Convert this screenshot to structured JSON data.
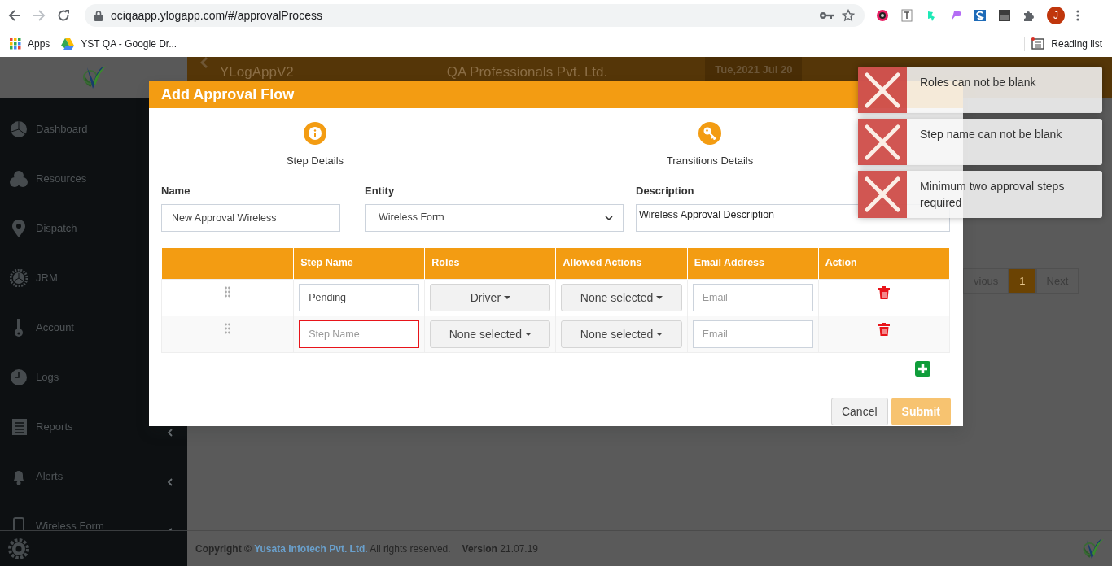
{
  "browser": {
    "url": "ociqaapp.ylogapp.com/#/approvalProcess",
    "profile_initial": "J",
    "bookmarks": [
      {
        "label": "Apps",
        "kind": "apps"
      },
      {
        "label": "YST QA - Google Dr...",
        "kind": "drive"
      }
    ],
    "reading_list": "Reading list"
  },
  "sidebar": {
    "items": [
      {
        "label": "Dashboard",
        "expandable": false
      },
      {
        "label": "Resources",
        "expandable": false
      },
      {
        "label": "Dispatch",
        "expandable": false
      },
      {
        "label": "JRM",
        "expandable": false
      },
      {
        "label": "Account",
        "expandable": false
      },
      {
        "label": "Logs",
        "expandable": false
      },
      {
        "label": "Reports",
        "expandable": true
      },
      {
        "label": "Alerts",
        "expandable": true
      },
      {
        "label": "Wireless Form",
        "expandable": true
      }
    ]
  },
  "header": {
    "app_name": "YLogAppV2",
    "company": "QA Professionals Pvt. Ltd.",
    "date": "Tue,2021 Jul 20"
  },
  "pagination": [
    {
      "label": "vious",
      "selected": false
    },
    {
      "label": "1",
      "selected": true
    },
    {
      "label": "Next",
      "selected": false
    }
  ],
  "footer": {
    "copyright": "**Copyright ©**",
    "company": "Yusata Infotech Pvt. Ltd.",
    "rights": "All rights reserved.",
    "version": "**Version** 21.07.19"
  },
  "modal": {
    "title": "Add Approval Flow",
    "steps": [
      {
        "label": "Step Details"
      },
      {
        "label": "Transitions Details"
      }
    ],
    "name": {
      "label": "Name",
      "value": "New Approval Wireless"
    },
    "entity": {
      "label": "Entity",
      "value": "Wireless Form"
    },
    "description": {
      "label": "Description",
      "value": "Wireless Approval Description"
    },
    "table": {
      "columns": [
        "Step Name",
        "Roles",
        "Allowed Actions",
        "Email Address",
        "Action"
      ],
      "rows": [
        {
          "step_name": "Pending",
          "invalid": false,
          "roles": "Driver",
          "actions": "None selected",
          "email_placeholder": "Email"
        },
        {
          "step_placeholder": "Step Name",
          "invalid": true,
          "roles": "None selected",
          "actions": "None selected",
          "email_placeholder": "Email"
        }
      ]
    },
    "buttons": [
      {
        "label": "Cancel",
        "kind": "secondary",
        "disabled": false
      },
      {
        "label": "Submit",
        "kind": "primary",
        "disabled": true
      }
    ]
  },
  "toasts": [
    {
      "message": "Roles can not be blank"
    },
    {
      "message": "Step name can not be blank"
    },
    {
      "message": "Minimum two approval steps required"
    }
  ]
}
